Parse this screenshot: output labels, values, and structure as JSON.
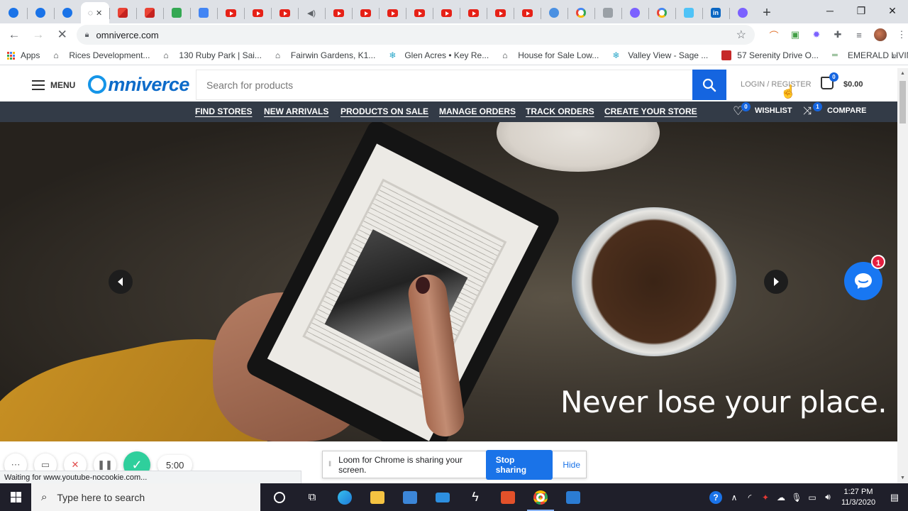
{
  "browser": {
    "url": "omniverce.com",
    "tabs": [
      {
        "icon": "omniverce"
      },
      {
        "icon": "omniverce"
      },
      {
        "icon": "omniverce"
      },
      {
        "icon": "loading",
        "active": true
      },
      {
        "icon": "gmail"
      },
      {
        "icon": "gmail"
      },
      {
        "icon": "app"
      },
      {
        "icon": "docs"
      },
      {
        "icon": "youtube"
      },
      {
        "icon": "youtube"
      },
      {
        "icon": "youtube"
      },
      {
        "icon": "youtube-audio"
      },
      {
        "icon": "youtube"
      },
      {
        "icon": "youtube"
      },
      {
        "icon": "youtube"
      },
      {
        "icon": "youtube"
      },
      {
        "icon": "youtube"
      },
      {
        "icon": "youtube"
      },
      {
        "icon": "youtube"
      },
      {
        "icon": "youtube"
      },
      {
        "icon": "circle-c"
      },
      {
        "icon": "google"
      },
      {
        "icon": "app"
      },
      {
        "icon": "gear"
      },
      {
        "icon": "google"
      },
      {
        "icon": "app"
      },
      {
        "icon": "linkedin"
      },
      {
        "icon": "gear"
      }
    ],
    "window_controls": {
      "minimize": "─",
      "maximize": "❐",
      "close": "✕"
    },
    "new_tab": "+",
    "bookmarks": [
      {
        "label": "Apps"
      },
      {
        "label": "Rices Development..."
      },
      {
        "label": "130 Ruby Park | Sai..."
      },
      {
        "label": "Fairwin Gardens, K1..."
      },
      {
        "label": "Glen Acres • Key Re..."
      },
      {
        "label": "House for Sale Low..."
      },
      {
        "label": "Valley View - Sage ..."
      },
      {
        "label": "57 Serenity Drive O..."
      },
      {
        "label": "EMERALD LIVING |..."
      }
    ],
    "bookmarks_more": "»"
  },
  "site": {
    "menu_label": "MENU",
    "logo_text": "mniverce",
    "search_placeholder": "Search for products",
    "login_label": "LOGIN / REGISTER",
    "cart_count": "0",
    "cart_total": "$0.00",
    "nav_items": [
      {
        "label": "FIND STORES"
      },
      {
        "label": "NEW ARRIVALS"
      },
      {
        "label": "PRODUCTS ON SALE"
      },
      {
        "label": "MANAGE ORDERS"
      },
      {
        "label": "TRACK ORDERS"
      },
      {
        "label": "CREATE YOUR STORE"
      }
    ],
    "wishlist_label": "WISHLIST",
    "wishlist_count": "0",
    "compare_label": "COMPARE",
    "compare_count": "1",
    "hero_text": "Never lose your place.",
    "chat_badge": "1"
  },
  "loom": {
    "timer": "5:00",
    "share_message": "Loom for Chrome is sharing your screen.",
    "stop_label": "Stop sharing",
    "hide_label": "Hide"
  },
  "status_bar": "Waiting for www.youtube-nocookie.com...",
  "taskbar": {
    "search_placeholder": "Type here to search",
    "time": "1:27 PM",
    "date": "11/3/2020"
  }
}
